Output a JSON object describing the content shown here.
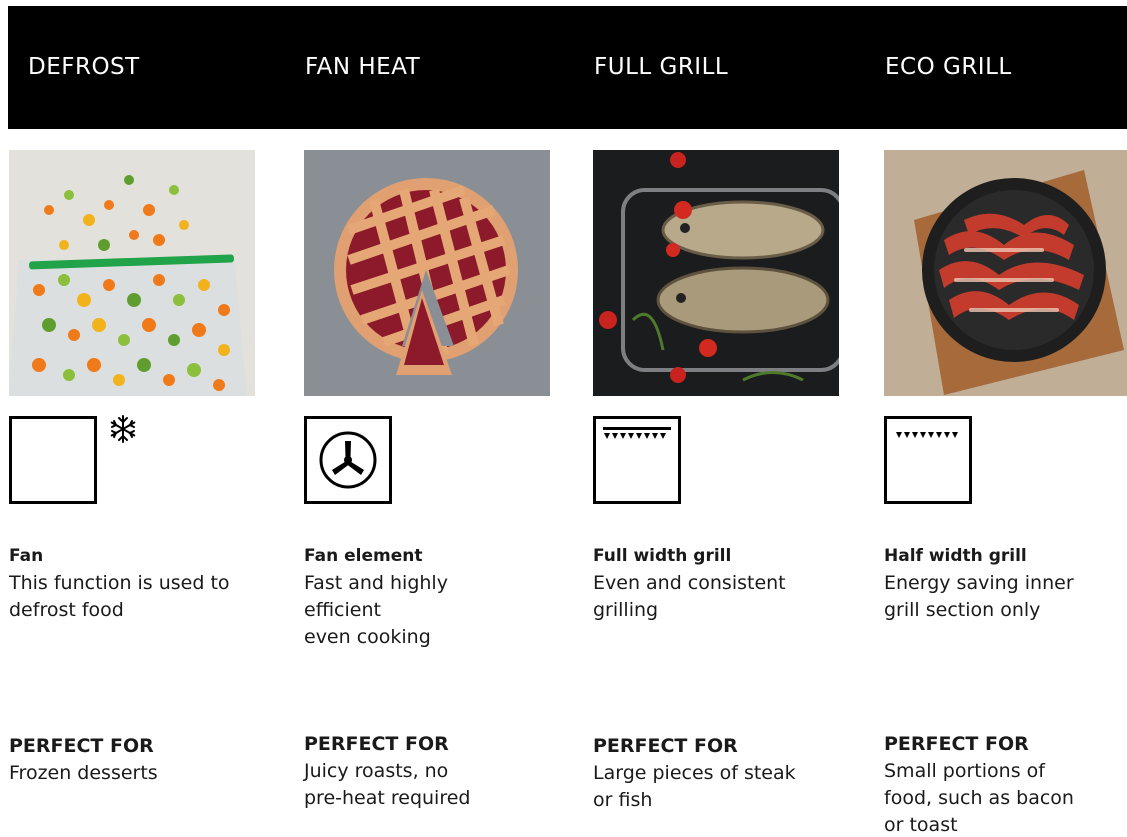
{
  "colors": {
    "header_bg": "#000000",
    "header_text": "#ffffff",
    "body_text": "#1a1a1a"
  },
  "columns": [
    {
      "title": "DEFROST",
      "image_icon": "frozen-vegetables-bag-image",
      "function_icon": "oven-box-icon",
      "extra_icon": "snowflake-icon",
      "desc_title": "Fan",
      "desc_text": "This function is used to\ndefrost food",
      "perfect_label": "PERFECT FOR",
      "perfect_text": "Frozen desserts"
    },
    {
      "title": "FAN HEAT",
      "image_icon": "lattice-pie-image",
      "function_icon": "fan-element-icon",
      "desc_title": "Fan element",
      "desc_text": "Fast and highly\nefficient\neven cooking",
      "perfect_label": "PERFECT FOR",
      "perfect_text": "Juicy roasts, no\npre-heat required"
    },
    {
      "title": "FULL GRILL",
      "image_icon": "grilled-fish-image",
      "function_icon": "full-grill-icon",
      "desc_title": "Full width grill",
      "desc_text": "Even and consistent\ngrilling",
      "perfect_label": "PERFECT FOR",
      "perfect_text": "Large pieces of steak\nor fish"
    },
    {
      "title": "ECO GRILL",
      "image_icon": "bacon-plate-image",
      "function_icon": "eco-grill-icon",
      "desc_title": "Half width grill",
      "desc_text": "Energy saving inner\ngrill section only",
      "perfect_label": "PERFECT FOR",
      "perfect_text": "Small portions of\nfood, such as bacon\nor toast"
    }
  ]
}
